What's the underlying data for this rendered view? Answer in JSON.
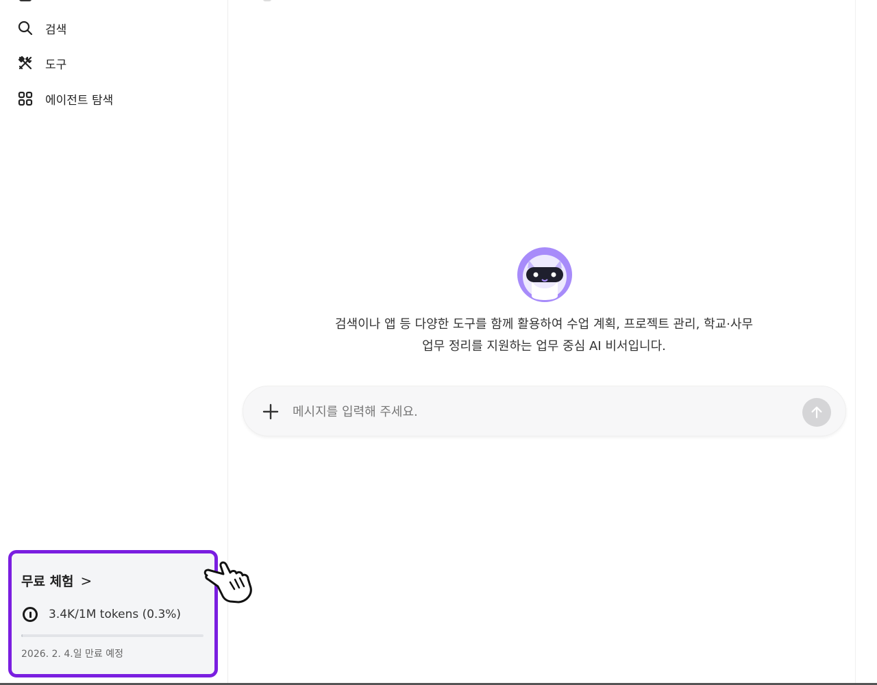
{
  "sidebar": {
    "items": [
      {
        "label": "검색",
        "icon": "search-icon"
      },
      {
        "label": "도구",
        "icon": "tools-icon"
      },
      {
        "label": "에이전트 탐색",
        "icon": "grid-icon"
      }
    ],
    "trial": {
      "title": "무료 체험",
      "chevron": ">",
      "tokens_text": "3.4K/1M tokens (0.3%)",
      "usage_percent": 0.3,
      "expire_text": "2026. 2. 4.일 만료 예정"
    }
  },
  "main": {
    "intro_line1": "검색이나 앱 등 다양한 도구를 함께 활용하여 수업 계획, 프로젝트 관리, 학교·사무",
    "intro_line2": "업무 정리를 지원하는 업무 중심 AI 비서입니다.",
    "input": {
      "placeholder": "메시지를 입력해 주세요."
    }
  },
  "colors": {
    "accent": "#7a1ee0",
    "avatar": "#a78bfa"
  }
}
